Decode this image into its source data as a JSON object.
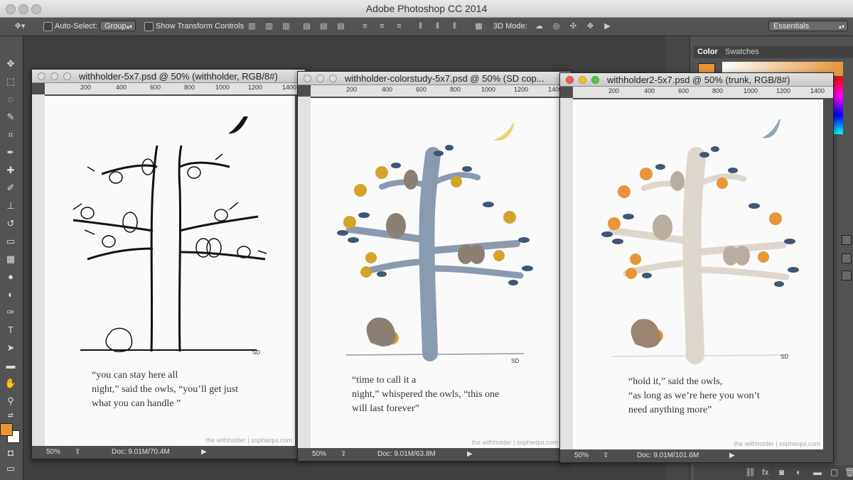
{
  "app": {
    "title": "Adobe Photoshop CC 2014"
  },
  "options_bar": {
    "auto_select_label": "Auto-Select:",
    "auto_select_value": "Group",
    "show_transform_label": "Show Transform Controls",
    "mode_3d_label": "3D Mode:",
    "workspace": "Essentials"
  },
  "panel": {
    "tab_color": "Color",
    "tab_swatches": "Swatches",
    "foreground_color": "#e8953a"
  },
  "documents": [
    {
      "title": "withholder-5x7.psd @ 50% (withholder, RGB/8#)",
      "ruler": [
        "200",
        "400",
        "600",
        "800",
        "1000",
        "1200",
        "1400"
      ],
      "caption": "“you can stay here all\nnight,” said the owls, “you’ll get just\nwhat you can handle ”",
      "signature": "SD",
      "credit": "the withholder | sophiequi.com",
      "zoom": "50%",
      "doc_size": "Doc: 9.01M/70.4M"
    },
    {
      "title": "withholder-colorstudy-5x7.psd @ 50% (SD cop...",
      "ruler": [
        "200",
        "400",
        "600",
        "800",
        "1000",
        "1200",
        "1400"
      ],
      "caption": "“time to call it a\nnight,” whispered the owls, “this one\nwill last forever”",
      "signature": "SD",
      "credit": "the withholder | sophiequi.com",
      "zoom": "50%",
      "doc_size": "Doc: 9.01M/63.8M"
    },
    {
      "title": "withholder2-5x7.psd @ 50% (trunk, RGB/8#)",
      "ruler": [
        "200",
        "400",
        "600",
        "800",
        "1000",
        "1200",
        "1400"
      ],
      "caption": "“hold it,” said the owls,\n“as long as we’re here you won’t\nneed anything more”",
      "signature": "SD",
      "credit": "the withholder | sophiequi.com",
      "zoom": "50%",
      "doc_size": "Doc: 9.01M/101.6M"
    }
  ],
  "colors": {
    "trunk_blue": "#8a9bb0",
    "apple_gold": "#d4a32c",
    "trunk_cream": "#ddd6cc",
    "apple_orange": "#e8953a",
    "leaf_navy": "#3f5775"
  }
}
